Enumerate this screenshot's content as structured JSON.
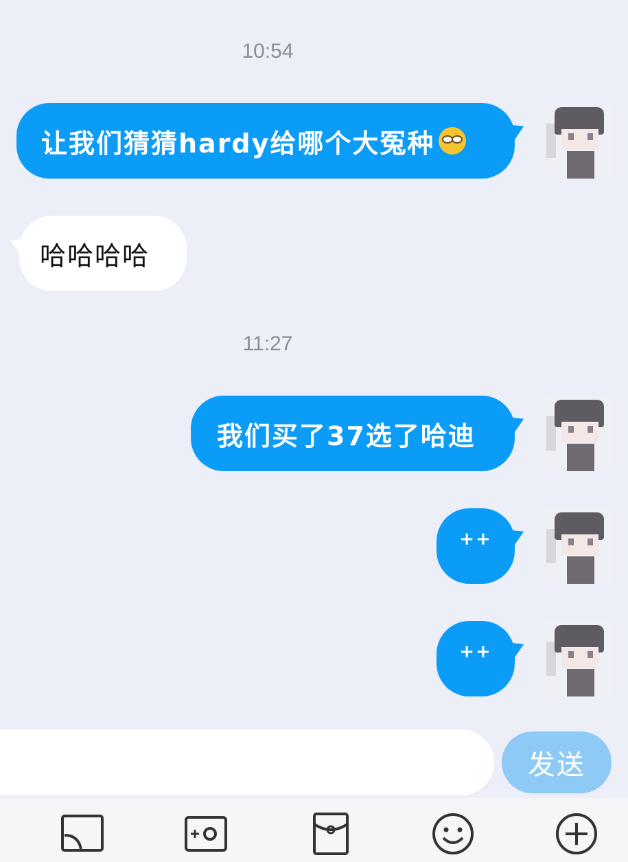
{
  "conversation": {
    "timestamps": [
      "10:54",
      "11:27"
    ],
    "messages": [
      {
        "side": "out",
        "text": "让我们猜猜hardy给哪个大冤种",
        "emoji": "smirk-emoji"
      },
      {
        "side": "in",
        "text": "哈哈哈哈"
      },
      {
        "side": "out",
        "text": "我们买了37选了哈迪"
      },
      {
        "side": "out",
        "text": "++"
      },
      {
        "side": "out",
        "text": "++"
      }
    ]
  },
  "composer": {
    "input_value": "",
    "input_placeholder": "",
    "send_label": "发送"
  },
  "toolbar": {
    "icons": [
      "screen-cast-icon",
      "camera-icon",
      "red-packet-icon",
      "smiley-icon",
      "plus-icon"
    ]
  },
  "colors": {
    "background": "#eceef8",
    "outgoing_bubble": "#0a9cf6",
    "incoming_bubble": "#ffffff",
    "send_button": "#8ecaf5"
  }
}
